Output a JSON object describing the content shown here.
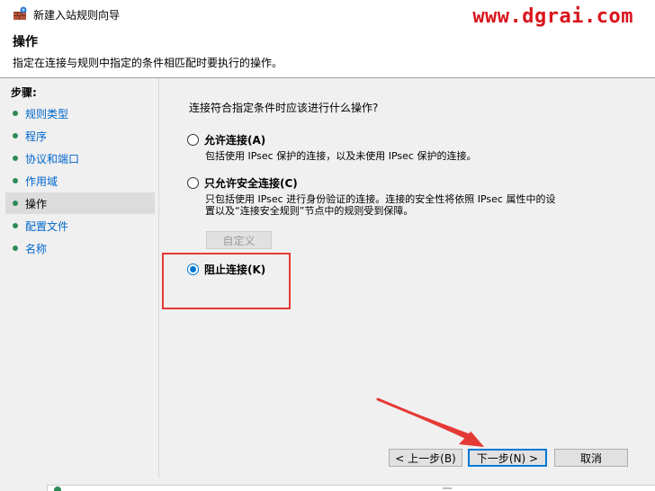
{
  "window": {
    "title": "新建入站规则向导",
    "icon": "firewall-wizard-icon"
  },
  "watermark": "www.dgrai.com",
  "header": {
    "title": "操作",
    "description": "指定在连接与规则中指定的条件相匹配时要执行的操作。"
  },
  "steps": {
    "label": "步骤:",
    "items": [
      {
        "label": "规则类型"
      },
      {
        "label": "程序"
      },
      {
        "label": "协议和端口"
      },
      {
        "label": "作用域"
      },
      {
        "label": "操作"
      },
      {
        "label": "配置文件"
      },
      {
        "label": "名称"
      }
    ],
    "active_index": 4
  },
  "main": {
    "question": "连接符合指定条件时应该进行什么操作?",
    "options": [
      {
        "label": "允许连接(A)",
        "description": "包括使用 IPsec 保护的连接，以及未使用 IPsec 保护的连接。",
        "checked": false
      },
      {
        "label": "只允许安全连接(C)",
        "description_line1": "只包括使用 IPsec 进行身份验证的连接。连接的安全性将依照 IPsec 属性中的设",
        "description_line2": "置以及“连接安全规则”节点中的规则受到保障。",
        "checked": false
      },
      {
        "label": "阻止连接(K)",
        "checked": true
      }
    ],
    "customize_label": "自定义"
  },
  "buttons": {
    "back": "< 上一步(B)",
    "next": "下一步(N) >",
    "cancel": "取消"
  },
  "colors": {
    "accent": "#0078d7",
    "link": "#0066cc",
    "highlight_box": "#e53935",
    "watermark": "#d9141b"
  }
}
